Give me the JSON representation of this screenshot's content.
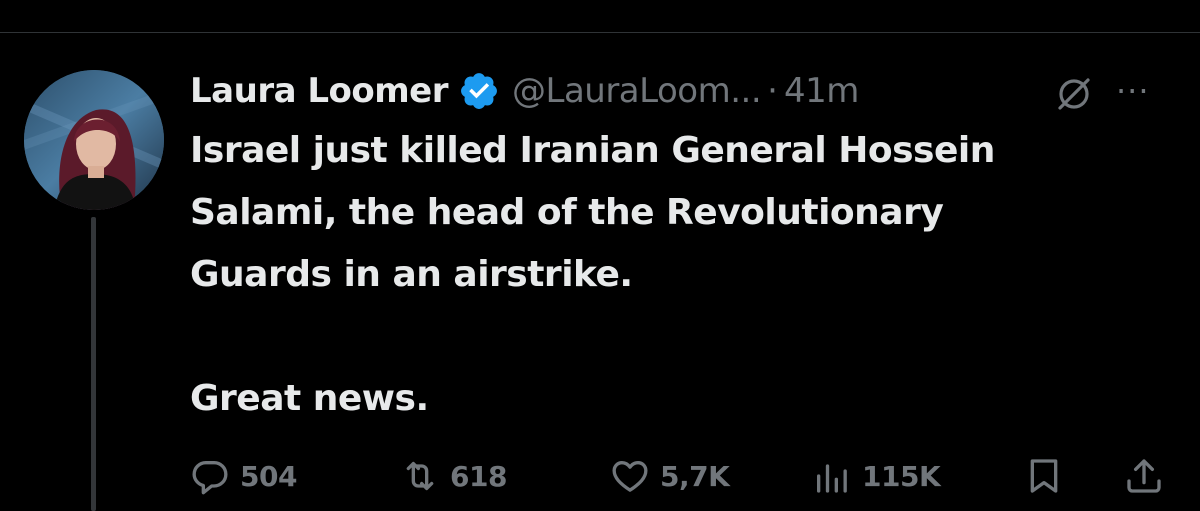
{
  "tweet": {
    "author_name": "Laura Loomer",
    "handle": "@LauraLoom...",
    "separator": "·",
    "time": "41m",
    "more_label": "···",
    "text_lines": [
      "Israel just killed Iranian General Hossein",
      "Salami, the head of the Revolutionary",
      "Guards in an airstrike."
    ],
    "text_second": "Great news."
  },
  "actions": {
    "replies": "504",
    "reposts": "618",
    "likes": "5,7K",
    "views": "115K"
  },
  "icons": {
    "verified": "verified-badge-icon",
    "grok": "grok-icon",
    "reply": "reply-icon",
    "repost": "repost-icon",
    "like": "heart-icon",
    "views": "views-icon",
    "bookmark": "bookmark-icon",
    "share": "share-icon"
  },
  "colors": {
    "background": "#000000",
    "text": "#e7e9ea",
    "muted": "#71767b",
    "verified": "#1d9bf0"
  }
}
